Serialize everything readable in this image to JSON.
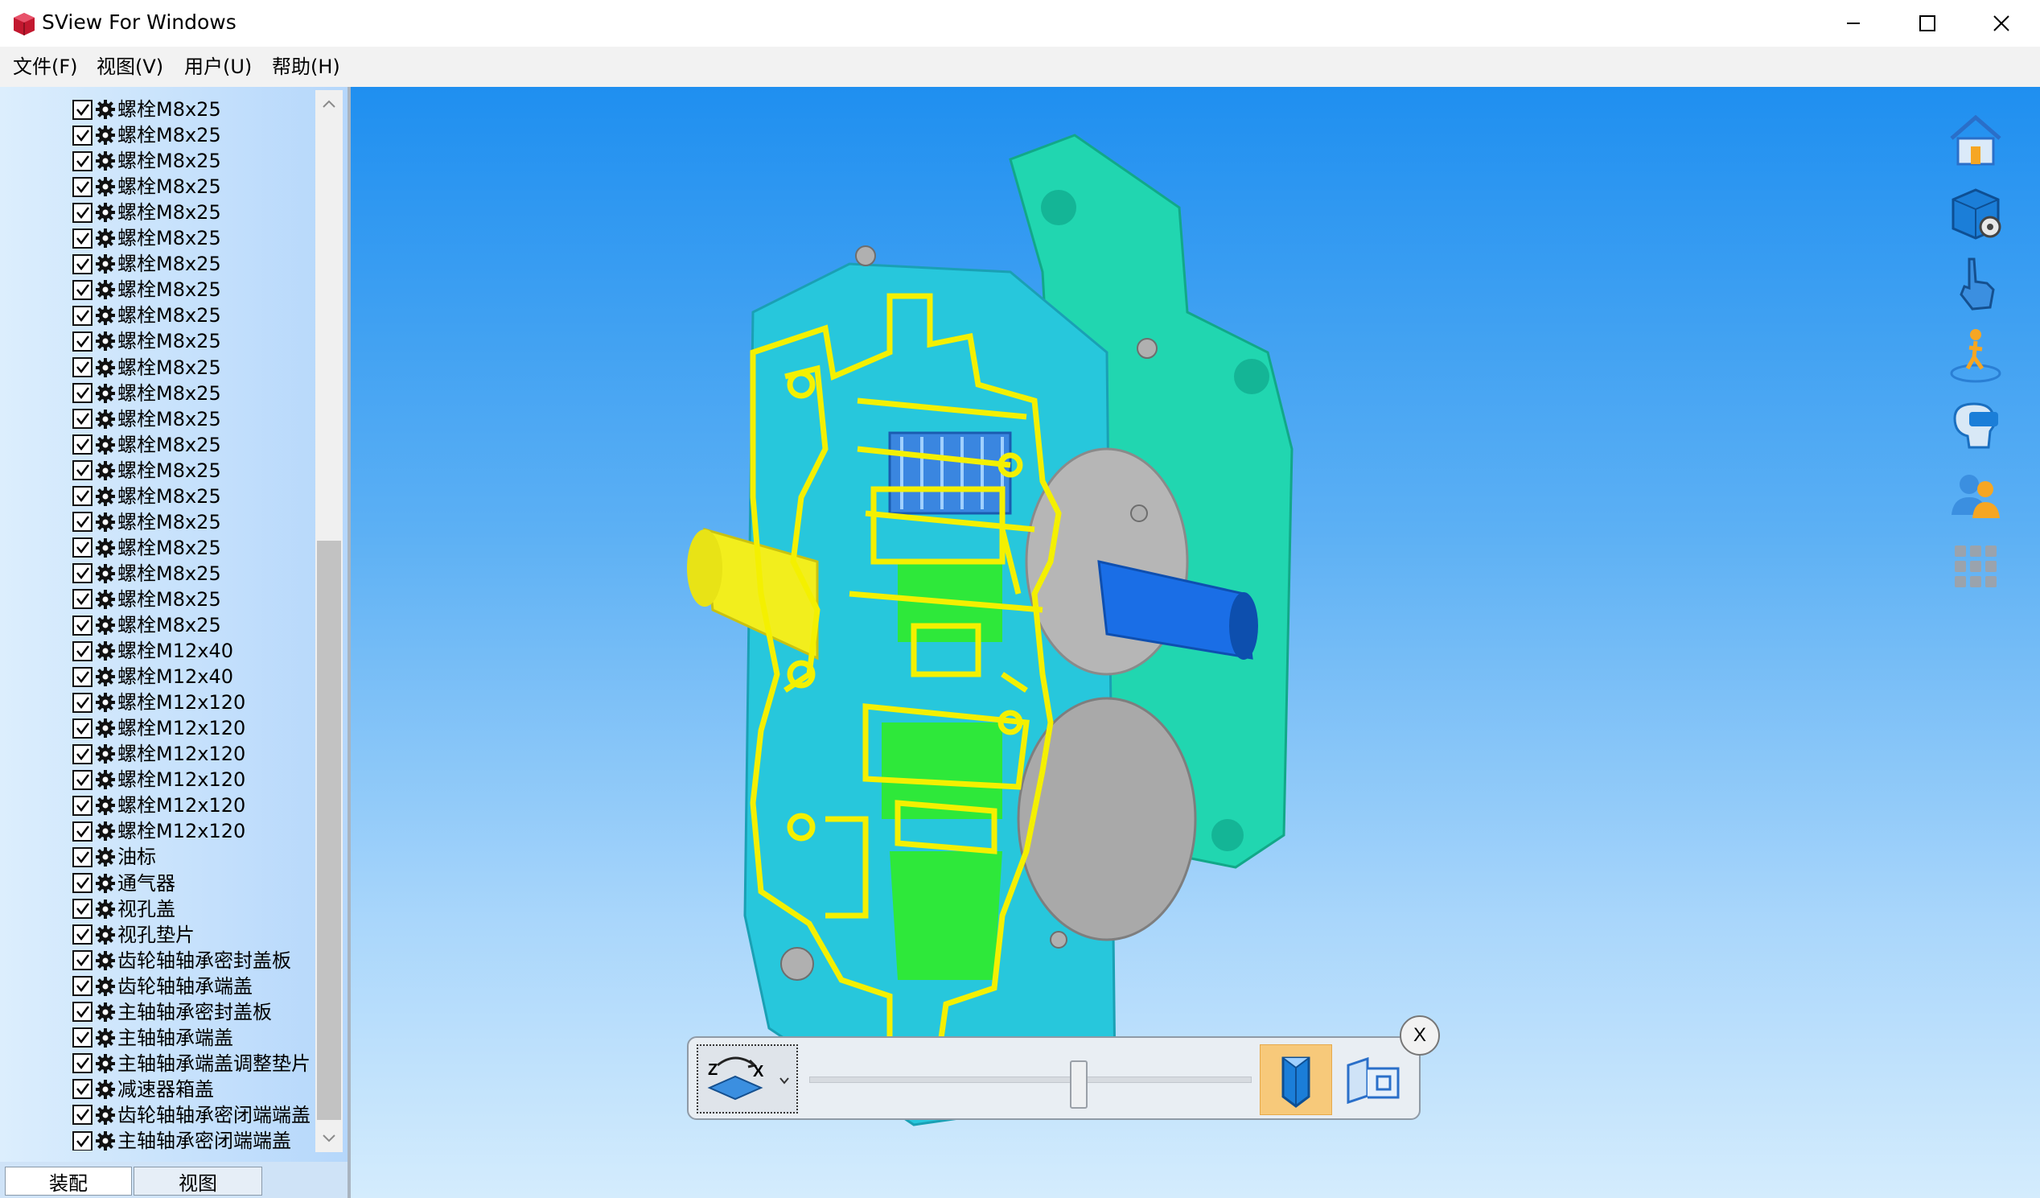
{
  "window": {
    "title": "SView For Windows"
  },
  "menu": [
    "文件(F)",
    "视图(V)",
    "用户(U)",
    "帮助(H)"
  ],
  "tree": {
    "items": [
      "螺栓M8x25",
      "螺栓M8x25",
      "螺栓M8x25",
      "螺栓M8x25",
      "螺栓M8x25",
      "螺栓M8x25",
      "螺栓M8x25",
      "螺栓M8x25",
      "螺栓M8x25",
      "螺栓M8x25",
      "螺栓M8x25",
      "螺栓M8x25",
      "螺栓M8x25",
      "螺栓M8x25",
      "螺栓M8x25",
      "螺栓M8x25",
      "螺栓M8x25",
      "螺栓M8x25",
      "螺栓M8x25",
      "螺栓M8x25",
      "螺栓M8x25",
      "螺栓M12x40",
      "螺栓M12x40",
      "螺栓M12x120",
      "螺栓M12x120",
      "螺栓M12x120",
      "螺栓M12x120",
      "螺栓M12x120",
      "螺栓M12x120",
      "油标",
      "通气器",
      "视孔盖",
      "视孔垫片",
      "齿轮轴轴承密封盖板",
      "齿轮轴轴承端盖",
      "主轴轴承密封盖板",
      "主轴轴承端盖",
      "主轴轴承端盖调整垫片",
      "减速器箱盖",
      "齿轮轴轴承密闭端端盖",
      "主轴轴承密闭端端盖"
    ]
  },
  "tabs": {
    "assembly": "装配",
    "view": "视图"
  },
  "section_tool": {
    "plane_axes": [
      "Z",
      "X"
    ],
    "close_label": "X"
  },
  "right_toolbar": [
    "home-icon",
    "model-settings-icon",
    "hand-pointer-icon",
    "walk-mode-icon",
    "vr-headset-icon",
    "users-icon",
    "apps-grid-icon"
  ],
  "colors": {
    "highlight": "#f4f000",
    "housing": "#21d6b0",
    "gear_blue": "#1a6ee6",
    "section_green": "#2ee83a",
    "viewport_top": "#1f8ff0",
    "viewport_bottom": "#d4ecfd"
  }
}
